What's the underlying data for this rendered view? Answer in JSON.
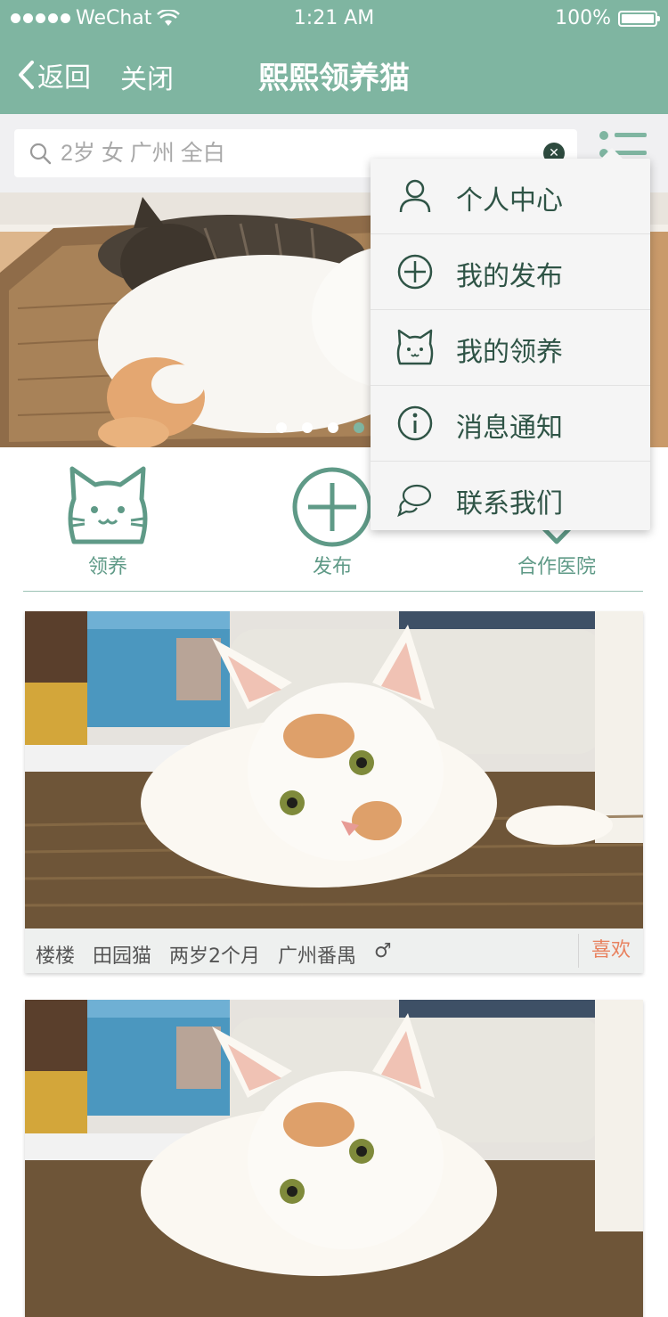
{
  "status_bar": {
    "carrier": "WeChat",
    "time": "1:21 AM",
    "battery": "100%"
  },
  "nav": {
    "back_label": "返回",
    "close_label": "关闭",
    "title": "熙熙领养猫"
  },
  "search": {
    "placeholder": "2岁 女 广州 全白",
    "value": ""
  },
  "banner": {
    "pages": 4,
    "active_page": 4
  },
  "shortcuts": [
    {
      "label": "领养",
      "icon": "cat-face-icon"
    },
    {
      "label": "发布",
      "icon": "plus-circle-icon"
    },
    {
      "label": "合作医院",
      "icon": "heart-icon"
    }
  ],
  "cards": [
    {
      "name": "楼楼",
      "breed": "田园猫",
      "age": "两岁2个月",
      "location": "广州番禺",
      "gender_symbol": "♂",
      "like_label": "喜欢"
    },
    {
      "name": "",
      "breed": "",
      "age": "",
      "location": "",
      "gender_symbol": "",
      "like_label": ""
    }
  ],
  "menu": {
    "items": [
      {
        "label": "个人中心",
        "icon": "person-icon"
      },
      {
        "label": "我的发布",
        "icon": "plus-circle-icon"
      },
      {
        "label": "我的领养",
        "icon": "cat-face-icon"
      },
      {
        "label": "消息通知",
        "icon": "info-icon"
      },
      {
        "label": "联系我们",
        "icon": "chat-bubbles-icon"
      }
    ]
  },
  "colors": {
    "brand": "#7fb5a1",
    "brand_dark": "#2f5446",
    "like": "#e8815e"
  }
}
